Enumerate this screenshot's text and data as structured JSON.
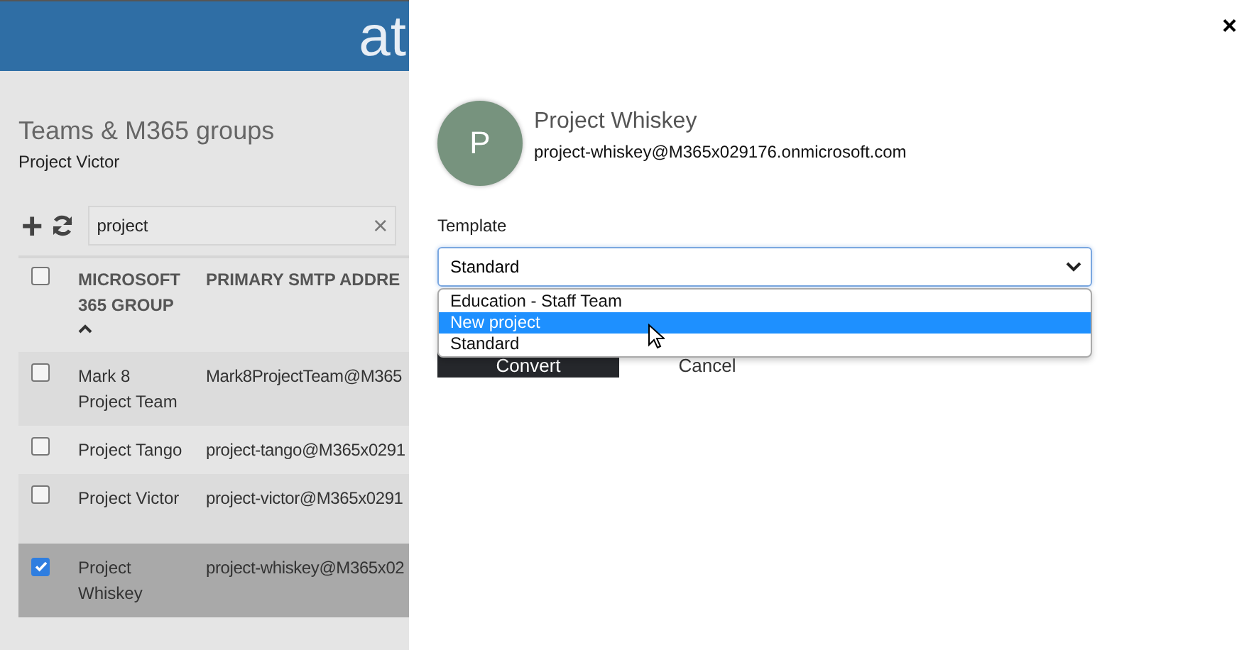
{
  "header": {
    "logo": "at"
  },
  "page": {
    "title": "Teams & M365 groups",
    "subtitle": "Project Victor"
  },
  "toolbar": {
    "add": "+",
    "search": {
      "value": "project",
      "clear": "×"
    }
  },
  "table": {
    "columns": [
      "MICROSOFT 365 GROUP",
      "PRIMARY SMTP ADDRE"
    ],
    "select_all": {
      "checked": false
    },
    "sorted_ascending": true,
    "rows": [
      {
        "name": "Mark 8 Project Team",
        "email": "Mark8ProjectTeam@M365",
        "selected": false
      },
      {
        "name": "Project Tango",
        "email": "project-tango@M365x0291",
        "selected": false
      },
      {
        "name": "Project Victor",
        "email": "project-victor@M365x0291",
        "selected": false
      },
      {
        "name": "Project Whiskey",
        "email": "project-whiskey@M365x02",
        "selected": true
      }
    ]
  },
  "panel": {
    "close": "×",
    "avatar": "P",
    "name": "Project Whiskey",
    "email": "project-whiskey@M365x029176.onmicrosoft.com",
    "template": {
      "label": "Template",
      "value": "Standard",
      "options": [
        {
          "label": "Education - Staff Team",
          "highlighted": false
        },
        {
          "label": "New project",
          "highlighted": true
        },
        {
          "label": "Standard",
          "highlighted": false
        }
      ]
    },
    "buttons": [
      {
        "label": "Convert",
        "kind": "primary"
      },
      {
        "label": "Cancel",
        "kind": "link"
      }
    ]
  }
}
